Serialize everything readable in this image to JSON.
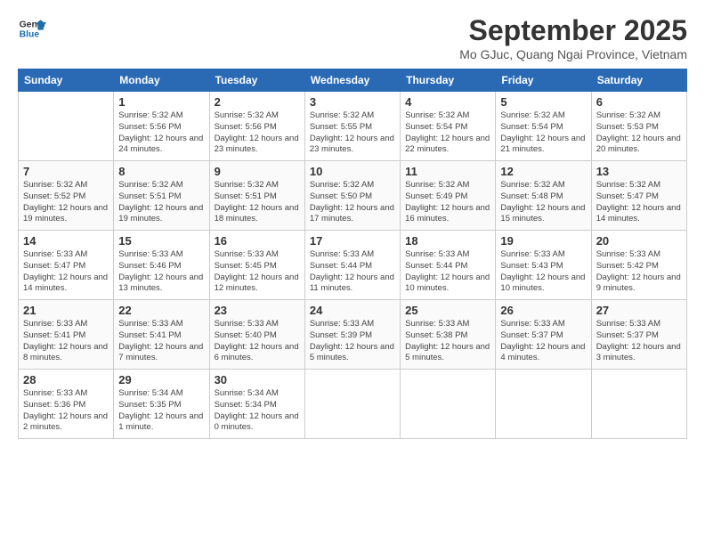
{
  "logo": {
    "line1": "General",
    "line2": "Blue"
  },
  "title": "September 2025",
  "location": "Mo GJuc, Quang Ngai Province, Vietnam",
  "days_of_week": [
    "Sunday",
    "Monday",
    "Tuesday",
    "Wednesday",
    "Thursday",
    "Friday",
    "Saturday"
  ],
  "weeks": [
    [
      {
        "day": "",
        "sunrise": "",
        "sunset": "",
        "daylight": ""
      },
      {
        "day": "1",
        "sunrise": "Sunrise: 5:32 AM",
        "sunset": "Sunset: 5:56 PM",
        "daylight": "Daylight: 12 hours and 24 minutes."
      },
      {
        "day": "2",
        "sunrise": "Sunrise: 5:32 AM",
        "sunset": "Sunset: 5:56 PM",
        "daylight": "Daylight: 12 hours and 23 minutes."
      },
      {
        "day": "3",
        "sunrise": "Sunrise: 5:32 AM",
        "sunset": "Sunset: 5:55 PM",
        "daylight": "Daylight: 12 hours and 23 minutes."
      },
      {
        "day": "4",
        "sunrise": "Sunrise: 5:32 AM",
        "sunset": "Sunset: 5:54 PM",
        "daylight": "Daylight: 12 hours and 22 minutes."
      },
      {
        "day": "5",
        "sunrise": "Sunrise: 5:32 AM",
        "sunset": "Sunset: 5:54 PM",
        "daylight": "Daylight: 12 hours and 21 minutes."
      },
      {
        "day": "6",
        "sunrise": "Sunrise: 5:32 AM",
        "sunset": "Sunset: 5:53 PM",
        "daylight": "Daylight: 12 hours and 20 minutes."
      }
    ],
    [
      {
        "day": "7",
        "sunrise": "Sunrise: 5:32 AM",
        "sunset": "Sunset: 5:52 PM",
        "daylight": "Daylight: 12 hours and 19 minutes."
      },
      {
        "day": "8",
        "sunrise": "Sunrise: 5:32 AM",
        "sunset": "Sunset: 5:51 PM",
        "daylight": "Daylight: 12 hours and 19 minutes."
      },
      {
        "day": "9",
        "sunrise": "Sunrise: 5:32 AM",
        "sunset": "Sunset: 5:51 PM",
        "daylight": "Daylight: 12 hours and 18 minutes."
      },
      {
        "day": "10",
        "sunrise": "Sunrise: 5:32 AM",
        "sunset": "Sunset: 5:50 PM",
        "daylight": "Daylight: 12 hours and 17 minutes."
      },
      {
        "day": "11",
        "sunrise": "Sunrise: 5:32 AM",
        "sunset": "Sunset: 5:49 PM",
        "daylight": "Daylight: 12 hours and 16 minutes."
      },
      {
        "day": "12",
        "sunrise": "Sunrise: 5:32 AM",
        "sunset": "Sunset: 5:48 PM",
        "daylight": "Daylight: 12 hours and 15 minutes."
      },
      {
        "day": "13",
        "sunrise": "Sunrise: 5:32 AM",
        "sunset": "Sunset: 5:47 PM",
        "daylight": "Daylight: 12 hours and 14 minutes."
      }
    ],
    [
      {
        "day": "14",
        "sunrise": "Sunrise: 5:33 AM",
        "sunset": "Sunset: 5:47 PM",
        "daylight": "Daylight: 12 hours and 14 minutes."
      },
      {
        "day": "15",
        "sunrise": "Sunrise: 5:33 AM",
        "sunset": "Sunset: 5:46 PM",
        "daylight": "Daylight: 12 hours and 13 minutes."
      },
      {
        "day": "16",
        "sunrise": "Sunrise: 5:33 AM",
        "sunset": "Sunset: 5:45 PM",
        "daylight": "Daylight: 12 hours and 12 minutes."
      },
      {
        "day": "17",
        "sunrise": "Sunrise: 5:33 AM",
        "sunset": "Sunset: 5:44 PM",
        "daylight": "Daylight: 12 hours and 11 minutes."
      },
      {
        "day": "18",
        "sunrise": "Sunrise: 5:33 AM",
        "sunset": "Sunset: 5:44 PM",
        "daylight": "Daylight: 12 hours and 10 minutes."
      },
      {
        "day": "19",
        "sunrise": "Sunrise: 5:33 AM",
        "sunset": "Sunset: 5:43 PM",
        "daylight": "Daylight: 12 hours and 10 minutes."
      },
      {
        "day": "20",
        "sunrise": "Sunrise: 5:33 AM",
        "sunset": "Sunset: 5:42 PM",
        "daylight": "Daylight: 12 hours and 9 minutes."
      }
    ],
    [
      {
        "day": "21",
        "sunrise": "Sunrise: 5:33 AM",
        "sunset": "Sunset: 5:41 PM",
        "daylight": "Daylight: 12 hours and 8 minutes."
      },
      {
        "day": "22",
        "sunrise": "Sunrise: 5:33 AM",
        "sunset": "Sunset: 5:41 PM",
        "daylight": "Daylight: 12 hours and 7 minutes."
      },
      {
        "day": "23",
        "sunrise": "Sunrise: 5:33 AM",
        "sunset": "Sunset: 5:40 PM",
        "daylight": "Daylight: 12 hours and 6 minutes."
      },
      {
        "day": "24",
        "sunrise": "Sunrise: 5:33 AM",
        "sunset": "Sunset: 5:39 PM",
        "daylight": "Daylight: 12 hours and 5 minutes."
      },
      {
        "day": "25",
        "sunrise": "Sunrise: 5:33 AM",
        "sunset": "Sunset: 5:38 PM",
        "daylight": "Daylight: 12 hours and 5 minutes."
      },
      {
        "day": "26",
        "sunrise": "Sunrise: 5:33 AM",
        "sunset": "Sunset: 5:37 PM",
        "daylight": "Daylight: 12 hours and 4 minutes."
      },
      {
        "day": "27",
        "sunrise": "Sunrise: 5:33 AM",
        "sunset": "Sunset: 5:37 PM",
        "daylight": "Daylight: 12 hours and 3 minutes."
      }
    ],
    [
      {
        "day": "28",
        "sunrise": "Sunrise: 5:33 AM",
        "sunset": "Sunset: 5:36 PM",
        "daylight": "Daylight: 12 hours and 2 minutes."
      },
      {
        "day": "29",
        "sunrise": "Sunrise: 5:34 AM",
        "sunset": "Sunset: 5:35 PM",
        "daylight": "Daylight: 12 hours and 1 minute."
      },
      {
        "day": "30",
        "sunrise": "Sunrise: 5:34 AM",
        "sunset": "Sunset: 5:34 PM",
        "daylight": "Daylight: 12 hours and 0 minutes."
      },
      {
        "day": "",
        "sunrise": "",
        "sunset": "",
        "daylight": ""
      },
      {
        "day": "",
        "sunrise": "",
        "sunset": "",
        "daylight": ""
      },
      {
        "day": "",
        "sunrise": "",
        "sunset": "",
        "daylight": ""
      },
      {
        "day": "",
        "sunrise": "",
        "sunset": "",
        "daylight": ""
      }
    ]
  ]
}
